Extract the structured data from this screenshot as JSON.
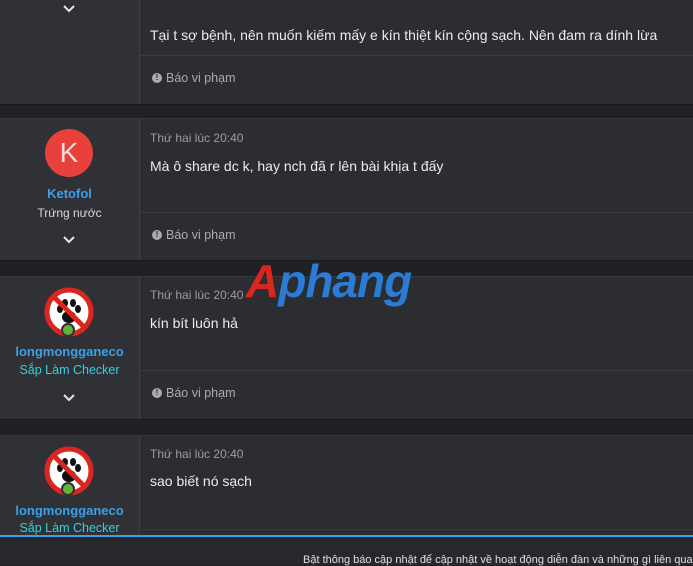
{
  "posts": [
    {
      "content": "Tại t sợ bệnh, nên muốn kiếm mấy e kín thiệt kín cộng sạch. Nên đam ra dính lừa",
      "report_label": "Báo vi phạm"
    },
    {
      "avatar_letter": "K",
      "username": "Ketofol",
      "user_title": "Trứng nước",
      "timestamp": "Thứ hai lúc 20:40",
      "content": "Mà ô share dc k, hay nch đã r lên bài khịa t đấy",
      "report_label": "Báo vi phạm"
    },
    {
      "username": "longmongganeco",
      "user_title": "Sắp Làm Checker",
      "timestamp": "Thứ hai lúc 20:40",
      "content": "kín bít luôn hả",
      "report_label": "Báo vi phạm"
    },
    {
      "username": "longmongganeco",
      "user_title": "Sắp Làm Checker",
      "timestamp": "Thứ hai lúc 20:40",
      "content": "sao biết nó sạch"
    }
  ],
  "watermark": {
    "first": "A",
    "rest": "phang"
  },
  "notice_text": "Bật thông báo cập nhật để cập nhật về hoạt động diễn đàn và những gì liên quan",
  "colors": {
    "username": "#3aa0e8",
    "title_highlight": "#36d1d8",
    "avatar_bg": "#e8403a",
    "online": "#63b33a",
    "accent": "#3aa0e8"
  }
}
